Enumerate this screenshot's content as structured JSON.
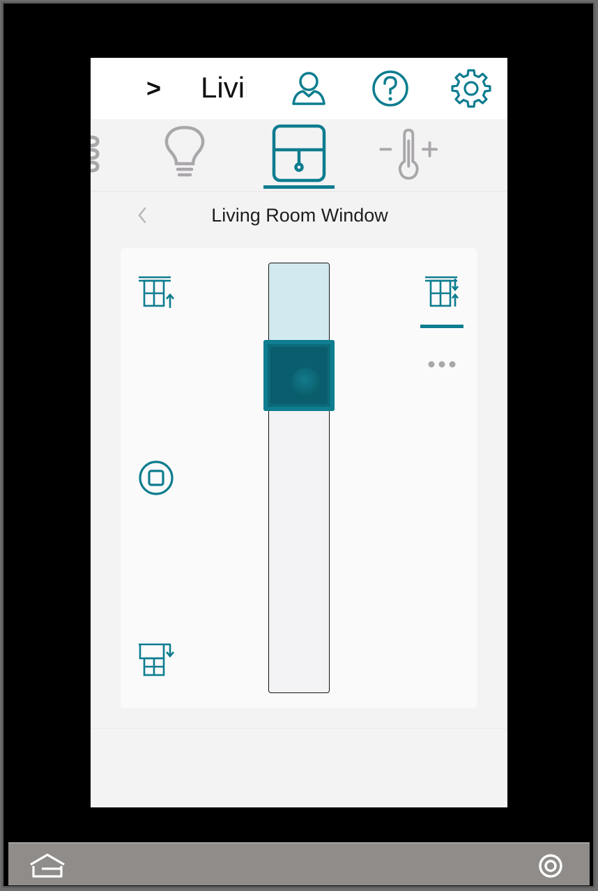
{
  "header": {
    "chevron_glyph": ">",
    "room_title": "Living Room",
    "icons": [
      "user-icon",
      "help-icon",
      "settings-icon"
    ]
  },
  "tabs": [
    {
      "name": "scenes-tab",
      "icon": "list-icon",
      "selected": false
    },
    {
      "name": "lighting-tab",
      "icon": "lightbulb-icon",
      "selected": false
    },
    {
      "name": "shades-tab",
      "icon": "window-shade-icon",
      "selected": true
    },
    {
      "name": "climate-tab",
      "icon": "thermometer-icon",
      "selected": false
    }
  ],
  "device": {
    "name": "Living Room Window"
  },
  "shade_control": {
    "open_percent": 82,
    "buttons": {
      "open": "shade-open-icon",
      "stop": "stop-icon",
      "close": "shade-close-icon",
      "mode": "shade-open-close-icon",
      "more": "more-icon"
    }
  },
  "colors": {
    "accent": "#0d7d8f",
    "accent_dark": "#0a5d6c",
    "track_fill": "#d2eaef",
    "inactive_icon": "#a9a7aa"
  },
  "bottom_bar": {
    "icons": [
      "home-icon",
      "power-icon"
    ]
  }
}
